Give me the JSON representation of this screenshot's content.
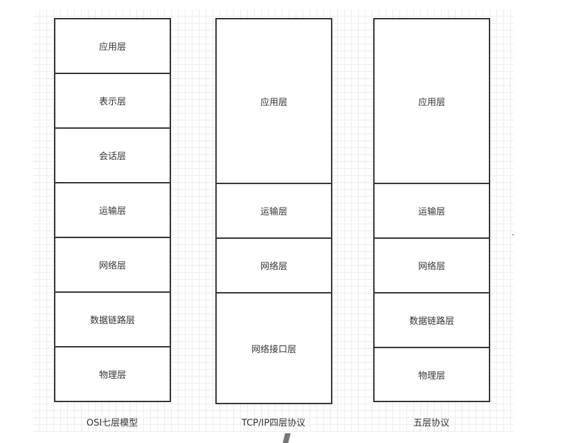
{
  "columns": [
    {
      "caption": "OSI七层模型",
      "layers": [
        {
          "label": "应用层"
        },
        {
          "label": "表示层"
        },
        {
          "label": "会话层"
        },
        {
          "label": "运输层"
        },
        {
          "label": "网络层"
        },
        {
          "label": "数据链路层"
        },
        {
          "label": "物理层"
        }
      ]
    },
    {
      "caption": "TCP/IP四层协议",
      "layers": [
        {
          "label": "应用层"
        },
        {
          "label": "运输层"
        },
        {
          "label": "网络层"
        },
        {
          "label": "网络接口层"
        }
      ]
    },
    {
      "caption": "五层协议",
      "layers": [
        {
          "label": "应用层"
        },
        {
          "label": "运输层"
        },
        {
          "label": "网络层"
        },
        {
          "label": "数据链路层"
        },
        {
          "label": "物理层"
        }
      ]
    }
  ]
}
